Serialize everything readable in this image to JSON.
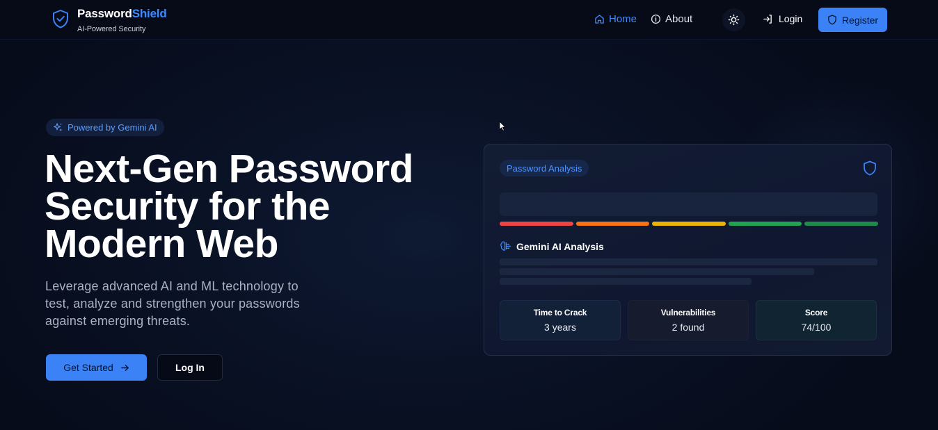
{
  "header": {
    "brand_part1": "Password",
    "brand_part2": "Shield",
    "tagline": "AI-Powered Security",
    "nav": {
      "home": "Home",
      "about": "About"
    },
    "login_label": "Login",
    "register_label": "Register"
  },
  "hero": {
    "badge": "Powered by Gemini AI",
    "headline": "Next-Gen Password Security for the Modern Web",
    "subtext": "Leverage advanced AI and ML technology to test, analyze and strengthen your passwords against emerging threats.",
    "get_started_label": "Get Started",
    "login_label": "Log In"
  },
  "card": {
    "chip": "Password Analysis",
    "strength_colors": [
      "#ef4444",
      "#f97316",
      "#eab308",
      "#22a354",
      "#1f8a4a"
    ],
    "ai_title": "Gemini AI Analysis",
    "stats": [
      {
        "label": "Time to Crack",
        "value": "3 years"
      },
      {
        "label": "Vulnerabilities",
        "value": "2 found"
      },
      {
        "label": "Score",
        "value": "74/100"
      }
    ]
  },
  "colors": {
    "accent": "#3b82f6",
    "background": "#070c1b"
  }
}
